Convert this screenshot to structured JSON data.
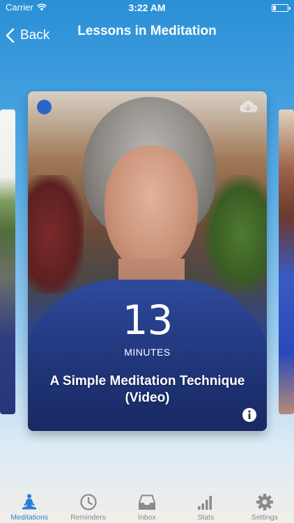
{
  "status_bar": {
    "carrier": "Carrier",
    "time": "3:22 AM",
    "battery_level": 0.2
  },
  "nav": {
    "back_label": "Back",
    "title": "Lessons in Meditation"
  },
  "card": {
    "duration": "13",
    "duration_unit": "MINUTES",
    "title": "A Simple Meditation Technique (Video)",
    "status_dot_color": "#2e63c8",
    "icons": [
      "cloud-download-icon",
      "info-icon"
    ]
  },
  "tabs": [
    {
      "label": "Meditations",
      "icon": "meditation-icon",
      "active": true
    },
    {
      "label": "Reminders",
      "icon": "clock-icon",
      "active": false
    },
    {
      "label": "Inbox",
      "icon": "inbox-icon",
      "active": false
    },
    {
      "label": "Stats",
      "icon": "bar-chart-icon",
      "active": false
    },
    {
      "label": "Settings",
      "icon": "gear-icon",
      "active": false
    }
  ],
  "colors": {
    "accent": "#2a7dd8",
    "inactive_tab": "#8a8a8a",
    "background_top": "#2a8fd6"
  }
}
